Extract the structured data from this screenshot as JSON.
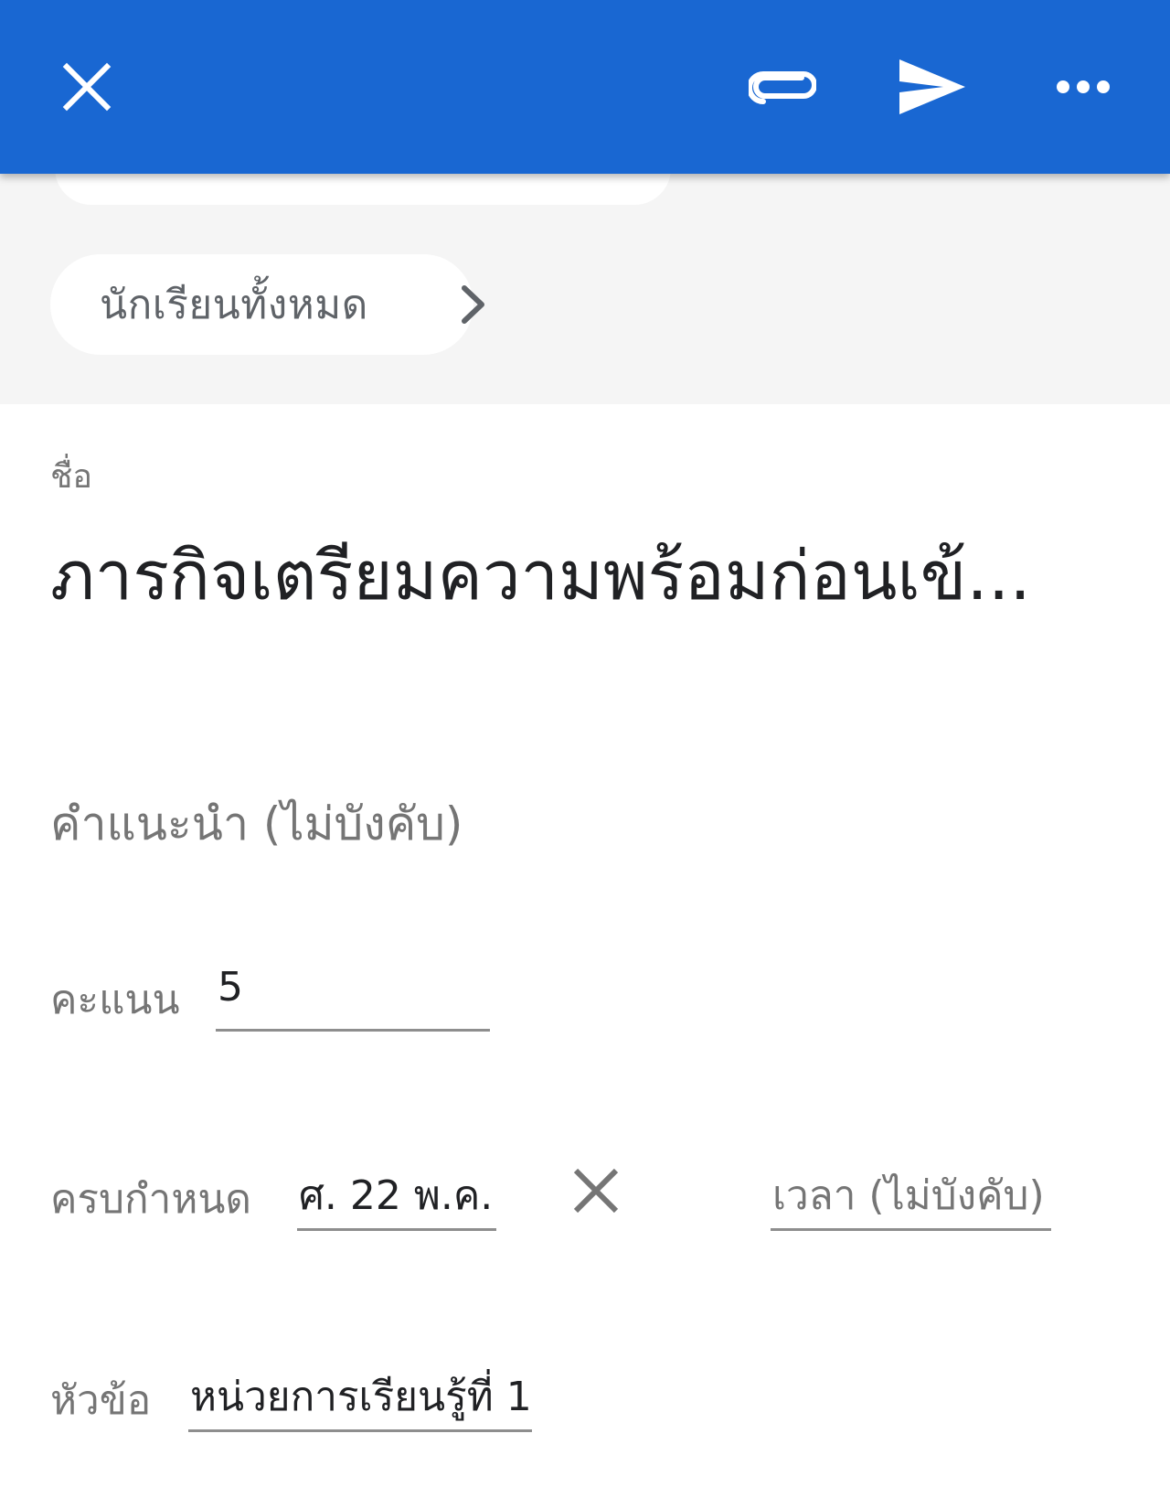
{
  "toolbar": {
    "close_icon": "close-icon",
    "attach_icon": "paperclip-icon",
    "send_icon": "send-icon",
    "more_icon": "more-horizontal-icon",
    "background_color": "#1967d2"
  },
  "audience": {
    "label": "นักเรียนทั้งหมด",
    "icon": "chevron-right-icon"
  },
  "form": {
    "title_caption": "ชื่อ",
    "title_value": "ภารกิจเตรียมความพร้อมก่อนเข้...",
    "instructions_placeholder": "คำแนะนำ (ไม่บังคับ)",
    "points_label": "คะแนน",
    "points_value": "5",
    "due_label": "ครบกำหนด",
    "due_value": "ศ. 22 พ.ค.",
    "clear_icon": "close-icon",
    "time_placeholder": "เวลา (ไม่บังคับ)",
    "topic_label": "หัวข้อ",
    "topic_value": "หน่วยการเรียนรู้ที่ 1"
  }
}
